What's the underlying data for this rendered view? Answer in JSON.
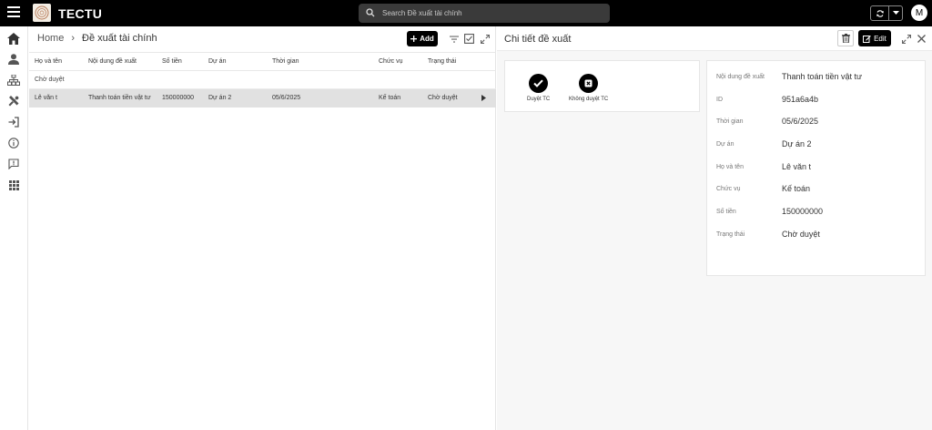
{
  "app": {
    "title": "TECTU"
  },
  "search": {
    "placeholder": "Search Đề xuất tài chính"
  },
  "user": {
    "avatar_initial": "M"
  },
  "colors": {
    "topbar": "#000000",
    "selected_row": "#e1e1e1",
    "accent": "#000000"
  },
  "sidebar": {
    "items": [
      {
        "icon": "home-icon"
      },
      {
        "icon": "person-icon"
      },
      {
        "icon": "org-chart-icon"
      },
      {
        "icon": "tools-icon"
      },
      {
        "icon": "login-icon"
      },
      {
        "icon": "info-icon"
      },
      {
        "icon": "feedback-icon"
      },
      {
        "icon": "apps-grid-icon"
      }
    ]
  },
  "list": {
    "breadcrumb": {
      "home": "Home",
      "current": "Đề xuất tài chính"
    },
    "add_label": "Add",
    "columns": [
      "Họ và tên",
      "Nội dung đề xuất",
      "Số tiền",
      "Dự án",
      "Thời gian",
      "Chức vụ",
      "Trạng thái"
    ],
    "group_label": "Chờ duyệt",
    "rows": [
      {
        "ho_ten": "Lê văn t",
        "noi_dung": "Thanh toán tiền vật tư",
        "so_tien": "150000000",
        "du_an": "Dự án 2",
        "thoi_gian": "05/6/2025",
        "chuc_vu": "Kế toán",
        "trang_thai": "Chờ duyệt"
      }
    ]
  },
  "detail": {
    "title": "Chi tiết đề xuất",
    "edit_label": "Edit",
    "actions": [
      {
        "label": "Duyệt TC",
        "icon": "check-icon"
      },
      {
        "label": "Không duyệt TC",
        "icon": "reject-icon"
      }
    ],
    "fields": [
      {
        "key": "Nội dung đề xuất",
        "value": "Thanh toán tiền vật tư"
      },
      {
        "key": "ID",
        "value": "951a6a4b"
      },
      {
        "key": "Thời gian",
        "value": "05/6/2025"
      },
      {
        "key": "Dự án",
        "value": "Dự án 2"
      },
      {
        "key": "Họ và tên",
        "value": "Lê văn t"
      },
      {
        "key": "Chức vụ",
        "value": "Kế toán"
      },
      {
        "key": "Số tiền",
        "value": "150000000"
      },
      {
        "key": "Trạng thái",
        "value": "Chờ duyệt"
      }
    ]
  }
}
